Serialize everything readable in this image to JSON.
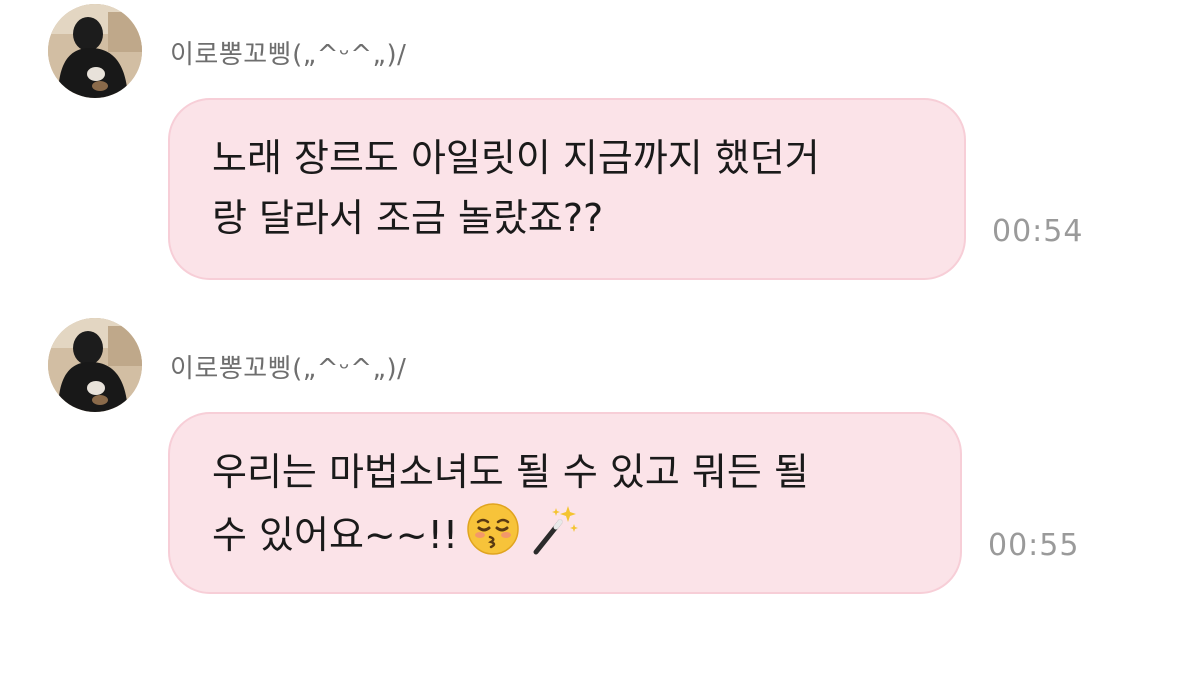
{
  "messages": [
    {
      "sender": "이로뽕꼬삥(„^ᵕ^„)/",
      "text": "노래 장르도 아일릿이 지금까지 했던거\n랑 달라서 조금 놀랐죠??",
      "time": "00:54",
      "emoji": []
    },
    {
      "sender": "이로뽕꼬삥(„^ᵕ^„)/",
      "text": "우리는 마법소녀도 될 수 있고 뭐든 될\n수 있어요~~!!",
      "time": "00:55",
      "emoji": [
        "kissing-face-with-closed-eyes-icon",
        "magic-wand-icon"
      ]
    }
  ],
  "colors": {
    "bubble_bg": "#fbe3e8",
    "bubble_border": "#f7ced7",
    "sender_text": "#6e6e6e",
    "time_text": "#9a9a9a"
  }
}
